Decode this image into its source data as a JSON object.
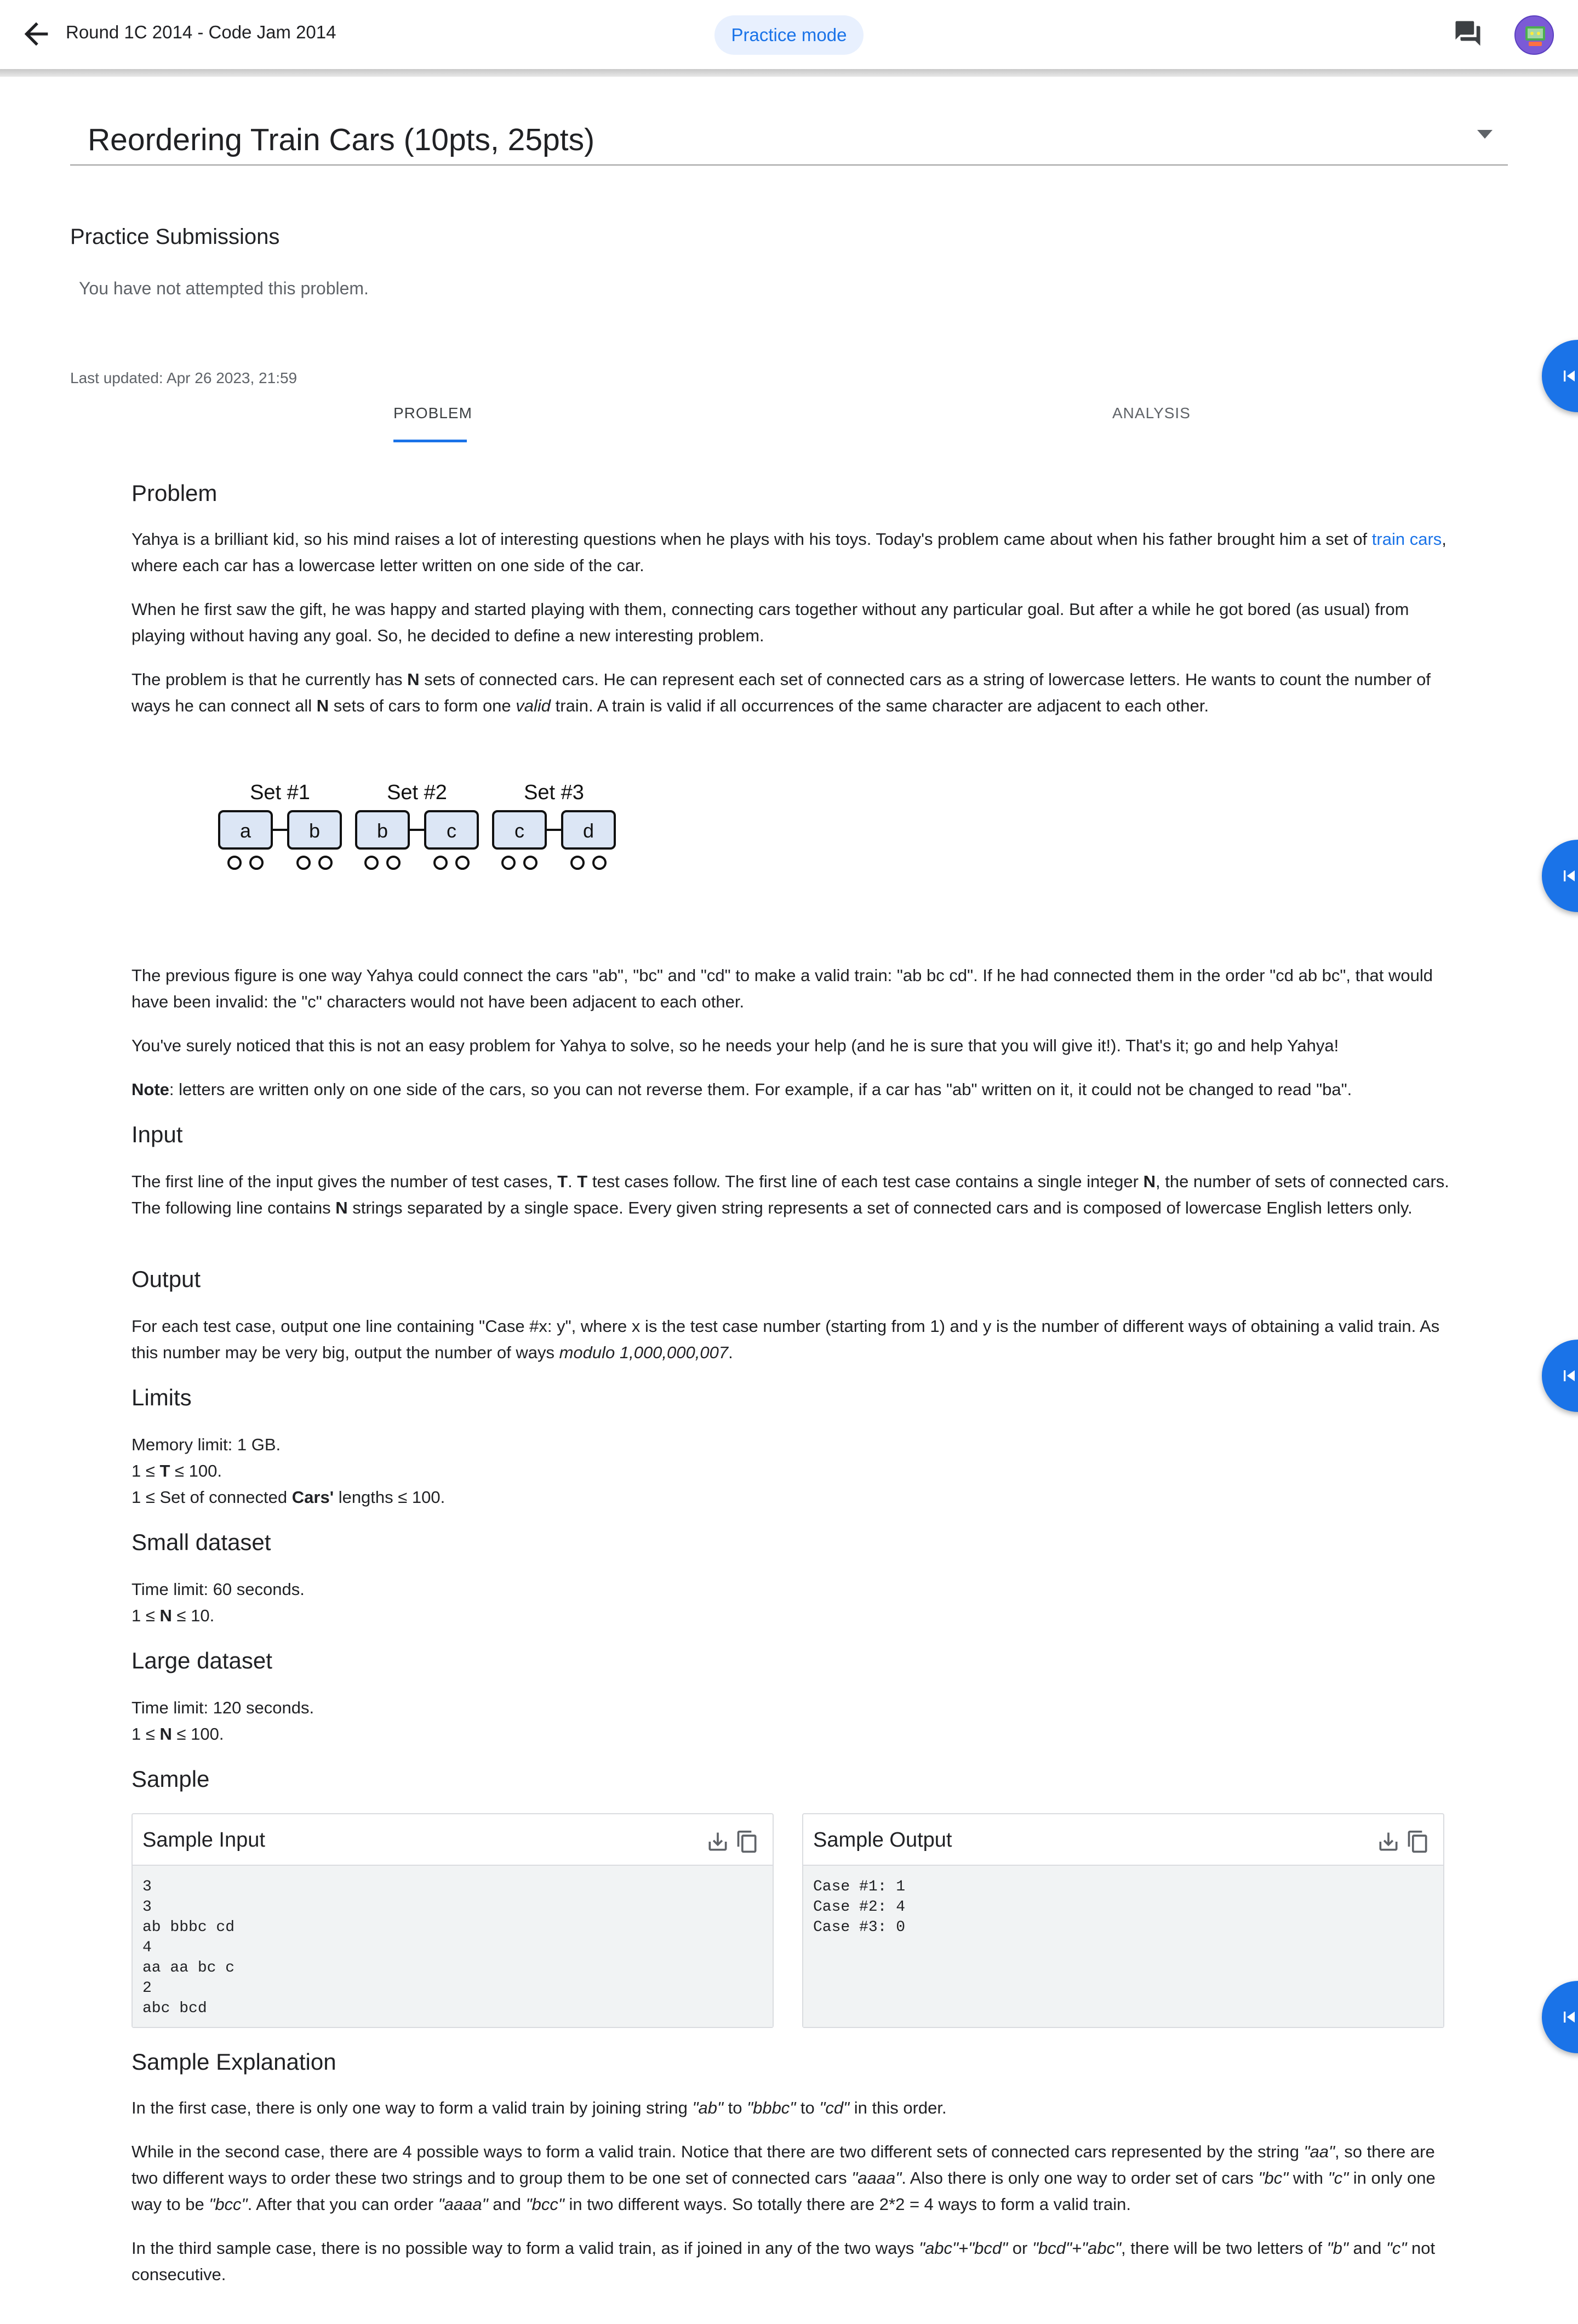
{
  "header": {
    "breadcrumb": "Round 1C 2014 - Code Jam 2014",
    "mode_chip": "Practice mode",
    "icons": {
      "back": "arrow-back-icon",
      "forum": "forum-icon",
      "avatar": "avatar"
    }
  },
  "problem_select": {
    "title": "Reordering Train Cars (10pts, 25pts)"
  },
  "submissions": {
    "title": "Practice Submissions",
    "note": "You have not attempted this problem."
  },
  "last_updated": "Last updated: Apr 26 2023, 21:59",
  "tabs": [
    {
      "label": "PROBLEM",
      "active": true
    },
    {
      "label": "ANALYSIS",
      "active": false
    }
  ],
  "statement": {
    "problem_heading": "Problem",
    "p1_a": "Yahya is a brilliant kid, so his mind raises a lot of interesting questions when he plays with his toys. Today's problem came about when his father brought him a set of ",
    "p1_link": "train cars",
    "p1_b": ", where each car has a lowercase letter written on one side of the car.",
    "p2": "When he first saw the gift, he was happy and started playing with them, connecting cars together without any particular goal. But after a while he got bored (as usual) from playing without having any goal. So, he decided to define a new interesting problem.",
    "p3_a": "The problem is that he currently has ",
    "p3_n": "N",
    "p3_b": " sets of connected cars. He can represent each set of connected cars as a string of lowercase letters. He wants to count the number of ways he can connect all ",
    "p3_n2": "N",
    "p3_c": " sets of cars to form one ",
    "p3_valid": "valid",
    "p3_d": " train. A train is valid if all occurrences of the same character are adjacent to each other.",
    "figure": {
      "set_labels": [
        "Set #1",
        "Set #2",
        "Set #3"
      ],
      "car_letters": [
        "a",
        "b",
        "b",
        "c",
        "c",
        "d"
      ]
    },
    "p4": "The previous figure is one way Yahya could connect the cars \"ab\", \"bc\" and \"cd\" to make a valid train: \"ab bc cd\". If he had connected them in the order \"cd ab bc\", that would have been invalid: the \"c\" characters would not have been adjacent to each other.",
    "p5": "You've surely noticed that this is not an easy problem for Yahya to solve, so he needs your help (and he is sure that you will give it!). That's it; go and help Yahya!",
    "p6_label": "Note",
    "p6": ": letters are written only on one side of the cars, so you can not reverse them. For example, if a car has \"ab\" written on it, it could not be changed to read \"ba\".",
    "input_heading": "Input",
    "input_a": "The first line of the input gives the number of test cases, ",
    "input_t": "T",
    "input_b": ". ",
    "input_t2": "T",
    "input_c": " test cases follow. The first line of each test case contains a single integer ",
    "input_n": "N",
    "input_d": ", the number of sets of connected cars. The following line contains ",
    "input_n2": "N",
    "input_e": " strings separated by a single space. Every given string represents a set of connected cars and is composed of lowercase English letters only.",
    "output_heading": "Output",
    "output_a": "For each test case, output one line containing \"Case #x: y\", where x is the test case number (starting from 1) and y is the number of different ways of obtaining a valid train. As this number may be very big, output the number of ways ",
    "output_mod": "modulo 1,000,000,007",
    "output_b": ".",
    "limits_heading": "Limits",
    "limits_mem": "Memory limit: 1 GB.",
    "limits_t_a": "1 ≤ ",
    "limits_t_b": "T",
    "limits_t_c": " ≤ 100.",
    "limits_cars_a": "1 ≤ Set of connected ",
    "limits_cars_b": "Cars'",
    "limits_cars_c": " lengths ≤ 100.",
    "small_heading": "Small dataset",
    "small_time": "Time limit: 60 seconds.",
    "small_n_a": "1 ≤ ",
    "small_n_b": "N",
    "small_n_c": " ≤ 10.",
    "large_heading": "Large dataset",
    "large_time": "Time limit: 120 seconds.",
    "large_n_a": "1 ≤ ",
    "large_n_b": "N",
    "large_n_c": " ≤ 100.",
    "sample_heading": "Sample",
    "sample_input_title": "Sample Input",
    "sample_input": "3\n3\nab bbbc cd\n4\naa aa bc c\n2\nabc bcd",
    "sample_output_title": "Sample Output",
    "sample_output": "Case #1: 1\nCase #2: 4\nCase #3: 0",
    "explanation_heading": "Sample Explanation",
    "e1_a": "In the first case, there is only one way to form a valid train by joining string ",
    "e1_ab": "\"ab\"",
    "e1_b": " to ",
    "e1_bbbc": "\"bbbc\"",
    "e1_c": " to ",
    "e1_cd": "\"cd\"",
    "e1_d": " in this order.",
    "e2_a": "While in the second case, there are 4 possible ways to form a valid train. Notice that there are two different sets of connected cars represented by the string ",
    "e2_aa": "\"aa\"",
    "e2_b": ", so there are two different ways to order these two strings and to group them to be one set of connected cars ",
    "e2_aaaa": "\"aaaa\"",
    "e2_c": ". Also there is only one way to order set of cars ",
    "e2_bc": "\"bc\"",
    "e2_d": " with ",
    "e2_c2": "\"c\"",
    "e2_e": " in only one way to be ",
    "e2_bcc": "\"bcc\"",
    "e2_f": ". After that you can order ",
    "e2_aaaa2": "\"aaaa\"",
    "e2_g": " and ",
    "e2_bcc2": "\"bcc\"",
    "e2_h": " in two different ways. So totally there are 2*2 = 4 ways to form a valid train.",
    "e3_a": "In the third sample case, there is no possible way to form a valid train, as if joined in any of the two ways ",
    "e3_w1": "\"abc\"+\"bcd\"",
    "e3_b": " or ",
    "e3_w2": "\"bcd\"+\"abc\"",
    "e3_c": ", there will be two letters of ",
    "e3_lb": "\"b\"",
    "e3_d": " and ",
    "e3_lc": "\"c\"",
    "e3_e": " not consecutive."
  },
  "sample_icons": [
    "download-icon",
    "copy-icon"
  ],
  "side_buttons": [
    "skip-previous-icon",
    "skip-previous-icon",
    "skip-previous-icon",
    "skip-previous-icon"
  ],
  "colors": {
    "accent": "#1a73e8",
    "chip_bg": "#e8f0fe",
    "car_fill": "#dce6f5"
  }
}
